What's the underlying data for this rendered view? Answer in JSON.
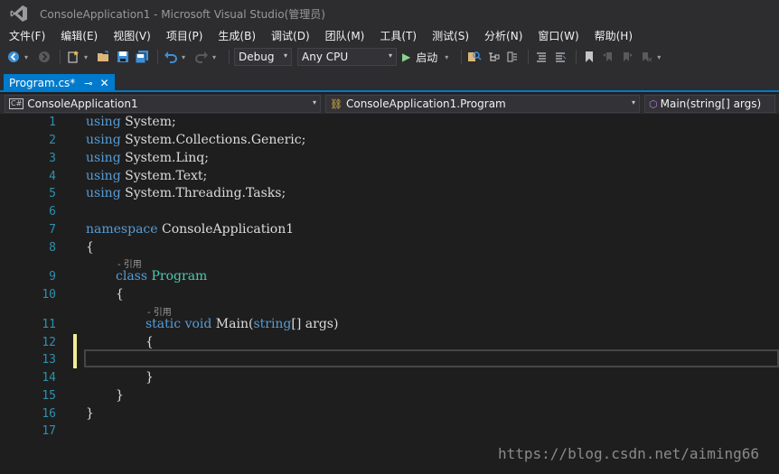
{
  "window": {
    "title": "ConsoleApplication1 - Microsoft Visual Studio(管理员)"
  },
  "menu": [
    "文件(F)",
    "编辑(E)",
    "视图(V)",
    "项目(P)",
    "生成(B)",
    "调试(D)",
    "团队(M)",
    "工具(T)",
    "测试(S)",
    "分析(N)",
    "窗口(W)",
    "帮助(H)"
  ],
  "toolbar": {
    "configuration": "Debug",
    "platform": "Any CPU",
    "start_label": "启动"
  },
  "tab": {
    "label": "Program.cs*",
    "pin_icon": "⊸",
    "close_icon": "✕"
  },
  "navbar": {
    "project": "ConsoleApplication1",
    "class": "ConsoleApplication1.Program",
    "member": "Main(string[] args)"
  },
  "editor": {
    "line_numbers": [
      "1",
      "2",
      "3",
      "4",
      "5",
      "6",
      "7",
      "8",
      "9",
      "10",
      "11",
      "12",
      "13",
      "14",
      "15",
      "16",
      "17"
    ],
    "lines": {
      "l1_kw": "using",
      "l1_rest": " System;",
      "l2_kw": "using",
      "l2_rest": " System.Collections.Generic;",
      "l3_kw": "using",
      "l3_rest": " System.Linq;",
      "l4_kw": "using",
      "l4_rest": " System.Text;",
      "l5_kw": "using",
      "l5_rest": " System.Threading.Tasks;",
      "l7_kw": "namespace",
      "l7_rest": " ConsoleApplication1",
      "l8": "{",
      "l9_kw": "class",
      "l9_type": "Program",
      "l10": "{",
      "l11_kw1": "static",
      "l11_kw2": "void",
      "l11_name": " Main(",
      "l11_kw3": "string",
      "l11_rest": "[] args)",
      "l12": "{",
      "l14": "}",
      "l15": "}",
      "l16": "}"
    },
    "codelens_class": "- 引用",
    "codelens_method": "- 引用"
  },
  "watermark": "https://blog.csdn.net/aiming66",
  "colors": {
    "accent": "#007acc",
    "keyword": "#569cd6",
    "type": "#4ec9b0",
    "line_number": "#2b91af",
    "change_marker": "#efef91"
  }
}
